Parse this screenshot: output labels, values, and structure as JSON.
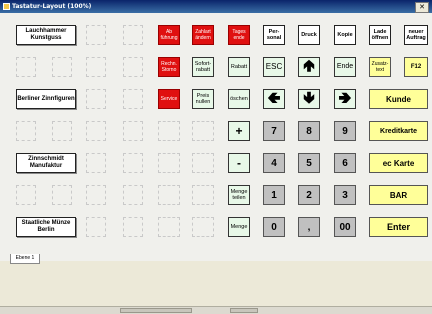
{
  "window": {
    "title": "Tastatur-Layout (100%)",
    "close": "✕"
  },
  "buttons": {
    "lauchhammer": "Lauchhammer Kunstguss",
    "berliner": "Berliner Zinnfiguren",
    "zinnschmidt": "Zinnschmidt Manufaktur",
    "staatliche": "Staatliche Münze Berlin",
    "ab_uhrung": "Ab führung",
    "zahlart": "Zahlart ändern",
    "tagesende": "Tages ende",
    "personal": "Per- sonal",
    "druck": "Druck",
    "kopie": "Kopie",
    "lade": "Lade öffnen",
    "neuer_auftrag": "neuer Auftrag",
    "rechn_storno": "Rechn. Storno",
    "sofort_rabatt": "Sofort- rabatt",
    "rabatt": "Rabatt",
    "esc": "ESC",
    "ende": "Ende",
    "zusatztext": "Zusatz- text",
    "f12": "F12",
    "service": "Service",
    "preis_nullen": "Preis nullen",
    "loeschen": "öschen",
    "kunde": "Kunde",
    "kreditkarte": "Kreditkarte",
    "ec_karte": "ec Karte",
    "bar": "BAR",
    "enter": "Enter",
    "menge_teilen": "Menge teilen",
    "menge": "Menge",
    "plus": "+",
    "minus": "-",
    "k7": "7",
    "k8": "8",
    "k9": "9",
    "k4": "4",
    "k5": "5",
    "k6": "6",
    "k1": "1",
    "k2": "2",
    "k3": "3",
    "k0": "0",
    "comma": ",",
    "k00": "00"
  },
  "tabs": {
    "ebene1": "Ebene 1"
  },
  "icons": {
    "up": "🢁",
    "left": "🢀",
    "down": "🢃",
    "right": "🢂"
  }
}
